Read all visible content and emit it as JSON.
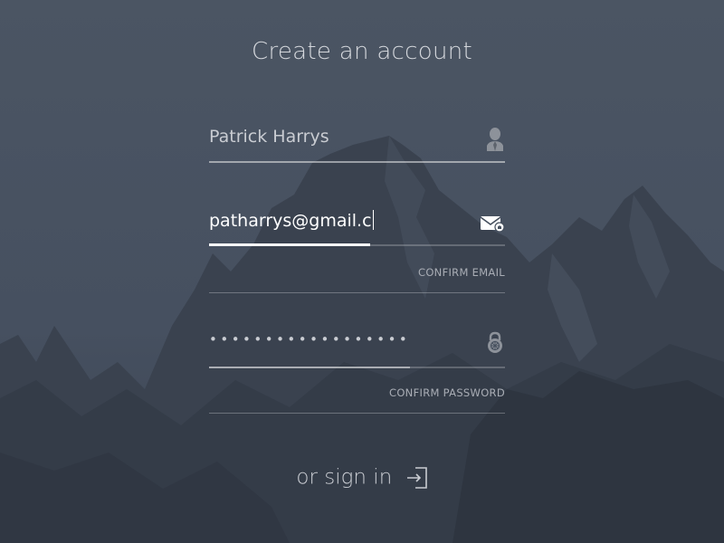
{
  "page": {
    "title": "Create an account",
    "accent": "#ffffff",
    "background": "#46505e"
  },
  "form": {
    "name": {
      "value": "Patrick Harrys",
      "icon": "user-icon"
    },
    "email": {
      "value": "patharrys@gmail.c",
      "icon": "mail-icon",
      "focused": true
    },
    "confirm_email": {
      "label": "CONFIRM EMAIL"
    },
    "password": {
      "value": "••••••••••••••••••",
      "icon": "lock-icon",
      "strength": 0.68
    },
    "confirm_password": {
      "label": "CONFIRM PASSWORD"
    }
  },
  "signin": {
    "label": "or sign in",
    "icon": "sign-in-icon"
  }
}
